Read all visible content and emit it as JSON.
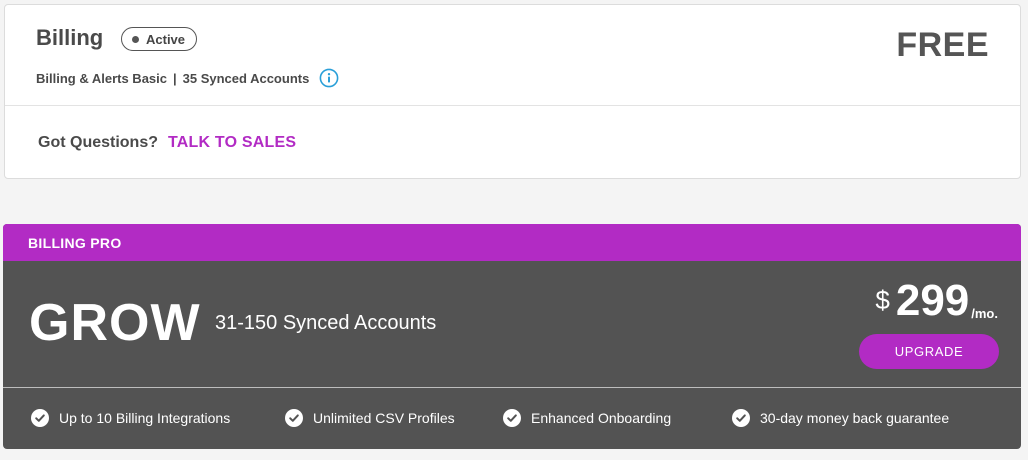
{
  "current_plan": {
    "name": "Billing",
    "status": "Active",
    "tier": "Billing & Alerts Basic",
    "separator": "|",
    "accounts": "35 Synced Accounts",
    "price": "FREE",
    "questions_label": "Got Questions?",
    "talk_link": "TALK TO SALES"
  },
  "pro_plan": {
    "header": "BILLING PRO",
    "tier_name": "GROW",
    "accounts": "31-150 Synced Accounts",
    "currency": "$",
    "amount": "299",
    "period": "/mo.",
    "upgrade_label": "UPGRADE",
    "features": [
      "Up to 10 Billing Integrations",
      "Unlimited CSV Profiles",
      "Enhanced Onboarding",
      "30-day money back guarantee"
    ]
  },
  "colors": {
    "accent": "#b22bc4",
    "pro_body": "#535353",
    "info_icon": "#2a9fd8"
  }
}
